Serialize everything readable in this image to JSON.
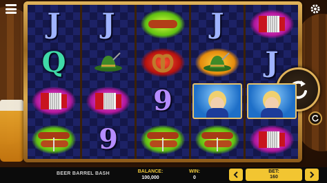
{
  "game": {
    "title": "BEER BARREL BASH"
  },
  "reels": [
    [
      "J",
      "Q",
      "accordion",
      "sausages"
    ],
    [
      "J",
      "hat",
      "accordion",
      "9"
    ],
    [
      "sausage",
      "pretzel",
      "9",
      "sausages"
    ],
    [
      "J",
      "hat",
      "waitress",
      "sausages"
    ],
    [
      "accordion",
      "J",
      "waitress",
      "accordion"
    ]
  ],
  "footer": {
    "balance_label": "BALANCE:",
    "balance_value": "100,000",
    "win_label": "WIN:",
    "win_value": "0",
    "bet_label": "BET:",
    "bet_value": "160"
  },
  "icons": {
    "spin": "spin-arrow-icon",
    "autoplay": "autoplay-icon",
    "menu": "hamburger-menu-icon",
    "settings": "gear-icon",
    "bet_decrease": "chevron-left-icon",
    "bet_increase": "chevron-right-icon"
  },
  "colors": {
    "accent": "#f2c531",
    "frame": "#d9a84c",
    "reel_bg": "#14174a"
  }
}
